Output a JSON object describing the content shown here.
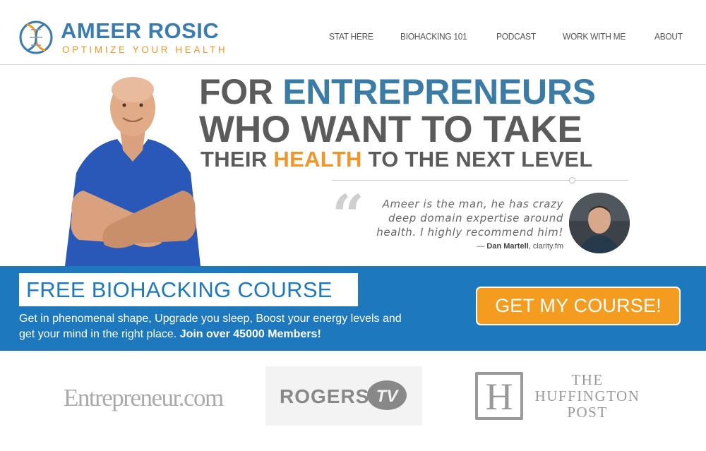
{
  "header": {
    "brand_name": "AMEER ROSIC",
    "brand_tagline": "OPTIMIZE YOUR HEALTH",
    "nav": [
      {
        "label": "STAT HERE"
      },
      {
        "label": "BIOHACKING 101"
      },
      {
        "label": "PODCAST"
      },
      {
        "label": "WORK WITH ME"
      },
      {
        "label": "ABOUT"
      }
    ]
  },
  "hero": {
    "line1_part1": "FOR ",
    "line1_part2": "ENTREPRENEURS",
    "line2": "WHO WANT TO TAKE",
    "line3_part1": "THEIR ",
    "line3_part2": "HEALTH",
    "line3_part3": " TO THE NEXT LEVEL",
    "quote_mark": "“",
    "testimonial": "Ameer is the man, he has crazy deep domain expertise around health. I highly recommend him!",
    "attribution_prefix": "— ",
    "attribution_name": "Dan Martell",
    "attribution_suffix": ", clarity.fm"
  },
  "course": {
    "title": "FREE BIOHACKING COURSE",
    "description": "Get in phenomenal shape, Upgrade you sleep, Boost your energy levels and get your mind in the right place. ",
    "members": "Join over 45000 Members!",
    "cta": "GET MY COURSE!"
  },
  "press": {
    "entrepreneur": "Entrepreneur",
    "entrepreneur_suffix": ".com",
    "rogers": "ROGERS",
    "rogers_tv": "TV",
    "huff_letter": "H",
    "huff_line1": "THE",
    "huff_line2": "HUFFINGTON",
    "huff_line3": "POST"
  },
  "colors": {
    "brand_blue": "#3a7ca5",
    "accent_orange": "#f0962a",
    "band_blue": "#1e78bd",
    "cta_orange": "#f39c1f"
  }
}
